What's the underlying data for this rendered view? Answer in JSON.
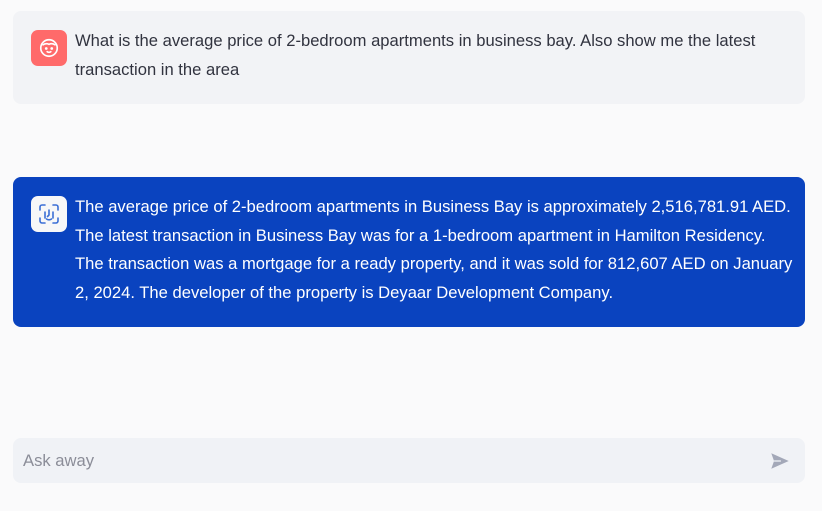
{
  "conversation": {
    "user_message": {
      "text": "What is the average price of 2-bedroom apartments in business bay. Also show me the latest transaction in the area",
      "avatar_icon": "user-face-icon",
      "avatar_color": "#ff6a6a"
    },
    "assistant_message": {
      "text": "The average price of 2-bedroom apartments in Business Bay is approximately 2,516,781.91 AED. The latest transaction in Business Bay was for a 1-bedroom apartment in Hamilton Residency. The transaction was a mortgage for a ready property, and it was sold for 812,607 AED on January 2, 2024. The developer of the property is Deyaar Development Company.",
      "avatar_icon": "assistant-face-scan-icon",
      "background_color": "#0a43bf"
    }
  },
  "chat_input": {
    "placeholder": "Ask away",
    "value": "",
    "send_icon": "send-icon"
  }
}
